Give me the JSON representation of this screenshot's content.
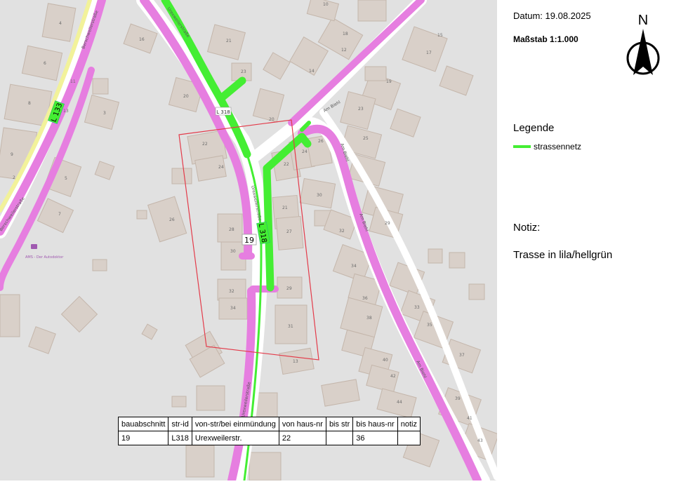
{
  "header": {
    "date_label": "Datum: 19.08.2025",
    "scale_label": "Maßstab 1:1.000"
  },
  "north_arrow": {
    "letter": "N",
    "icon": "north-arrow-icon"
  },
  "legend": {
    "title": "Legende",
    "items": [
      {
        "label": "strassennetz",
        "color": "#44ee33"
      }
    ]
  },
  "notes": {
    "title": "Notiz:",
    "text": "Trasse in lila/hellgrün"
  },
  "colors": {
    "map_background": "#e1e1e1",
    "building": "#d9d0c9",
    "building_outline": "#c4b6ab",
    "route_lila": "#e67ee0",
    "route_green": "#44ee33",
    "area_outline": "#e33b4a",
    "road": "#ffffff"
  },
  "map": {
    "road_labels": {
      "l318_shield": "L 318",
      "l133_shield": "L 133",
      "l318_small": "L 318",
      "urexweiler_top": "Urexweilerstraße",
      "urexweiler_mid": "Urexweilerstraße",
      "urexweiler_bottom": "Urexweilerstraße",
      "am_biehl_top": "Am Biehl",
      "am_biehl_mid": "Am Biehl",
      "am_biehl_low": "Am Biehl",
      "am_biehl_bottom": "Am Biehl",
      "berschweiler_top": "Berschweilerstraße",
      "berschweiler_bottom": "Berschweilerstraße"
    },
    "section_marker": "19",
    "poi_label": "AMS - Der Autodoktor",
    "house_numbers": [
      "4",
      "16",
      "21",
      "23",
      "20",
      "18",
      "15",
      "17",
      "10",
      "12",
      "19",
      "14",
      "20",
      "22",
      "24",
      "26",
      "22",
      "24",
      "30",
      "21",
      "23",
      "25",
      "27",
      "29",
      "28",
      "30",
      "26",
      "32",
      "34",
      "29",
      "31",
      "32",
      "34",
      "35",
      "36",
      "38",
      "33",
      "37",
      "40",
      "42",
      "39",
      "41",
      "43",
      "44",
      "13",
      "2",
      "3",
      "5",
      "6",
      "7",
      "8",
      "9",
      "11",
      "13"
    ]
  },
  "table": {
    "headers": [
      "bauabschnitt",
      "str-id",
      "von-str/bei einmündung",
      "von haus-nr",
      "bis str",
      "bis haus-nr",
      "notiz"
    ],
    "rows": [
      [
        "19",
        "L318",
        "Urexweilerstr.",
        "22",
        "",
        "36",
        ""
      ]
    ]
  }
}
